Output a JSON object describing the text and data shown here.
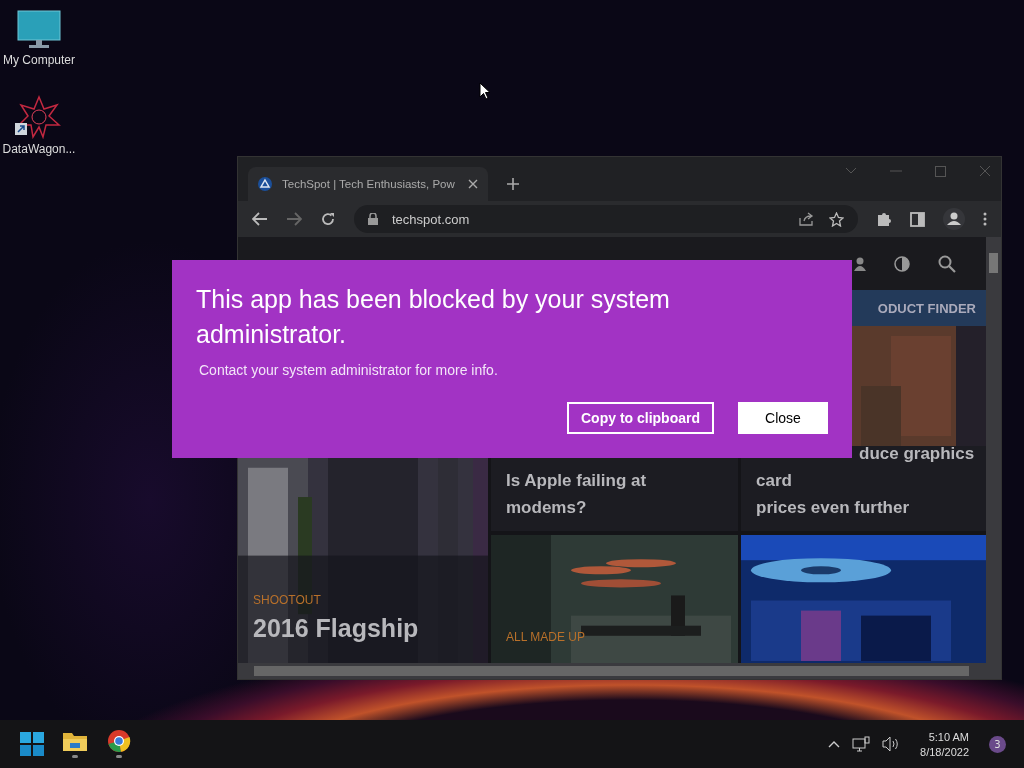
{
  "desktop_icons": [
    {
      "kind": "computer",
      "label": "My Computer"
    },
    {
      "kind": "shortcut",
      "label": "DataWagon..."
    }
  ],
  "browser": {
    "tab": {
      "title": "TechSpot | Tech Enthusiasts, Pow"
    },
    "address": "techspot.com",
    "page": {
      "nav_link": "ODUCT FINDER",
      "cards": [
        {
          "kind": "tall",
          "label": "SHOOTOUT",
          "headline_lines": [
            "2016 Flagship"
          ]
        },
        {
          "kind": "top",
          "headline_lines": [
            "Is Apple failing at",
            "modems?"
          ]
        },
        {
          "kind": "top-cut",
          "headline_lines": [
            "duce graphics",
            "card",
            "prices even further"
          ]
        },
        {
          "kind": "bottom",
          "label": "ALL MADE UP"
        },
        {
          "kind": "bottom"
        }
      ]
    }
  },
  "dialog": {
    "title": "This app has been blocked by your system administrator.",
    "message": "Contact your system administrator for more info.",
    "buttons": [
      {
        "label": "Copy to clipboard",
        "kind": "outline"
      },
      {
        "label": "Close",
        "kind": "solid"
      }
    ]
  },
  "taskbar": {
    "apps": [
      {
        "kind": "start"
      },
      {
        "kind": "explorer"
      },
      {
        "kind": "chrome"
      }
    ],
    "time": "5:10 AM",
    "date": "8/18/2022",
    "notifications": "3"
  }
}
